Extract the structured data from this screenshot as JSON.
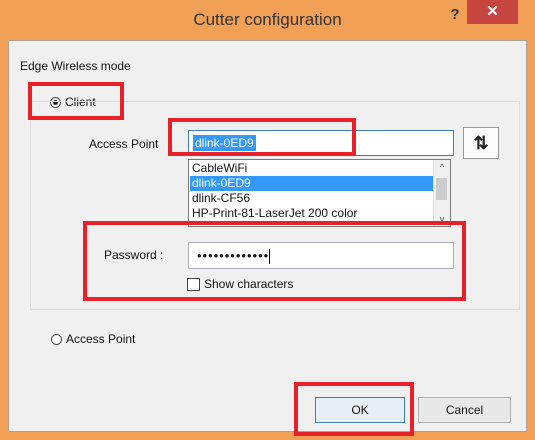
{
  "window": {
    "title": "Cutter configuration",
    "help_glyph": "?",
    "close_glyph": "✕"
  },
  "edge": {
    "label": "Edge Wireless mode"
  },
  "client_radio": {
    "label": "Client",
    "checked": true
  },
  "access_point": {
    "label": "Access Point",
    "value": "dlink-0ED9",
    "refresh_icon": "⇅",
    "scroll_up": "^",
    "scroll_down": "v",
    "networks": [
      {
        "name": "CableWiFi",
        "selected": false
      },
      {
        "name": "dlink-0ED9",
        "selected": true
      },
      {
        "name": "dlink-CF56",
        "selected": false
      },
      {
        "name": "HP-Print-81-LaserJet 200 color",
        "selected": false
      }
    ]
  },
  "password": {
    "label": "Password :",
    "masked_value": "•••••••••••••"
  },
  "show_characters": {
    "label": "Show characters",
    "checked": false
  },
  "ap_radio": {
    "label": "Access Point",
    "checked": false
  },
  "buttons": {
    "ok": "OK",
    "cancel": "Cancel"
  },
  "colors": {
    "highlight": "#e8202a",
    "selection": "#3399ff",
    "close_button": "#c7463f"
  }
}
